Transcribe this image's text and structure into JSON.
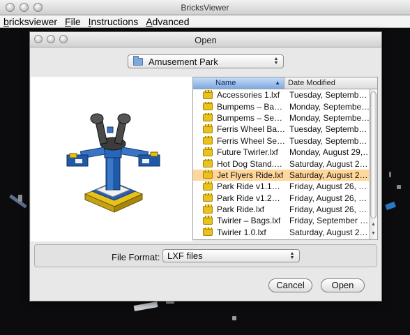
{
  "app": {
    "title": "BricksViewer"
  },
  "menubar": {
    "items": [
      "bricksviewer",
      "File",
      "Instructions",
      "Advanced"
    ]
  },
  "dialog": {
    "title": "Open",
    "folder": "Amusement Park",
    "columns": {
      "name": "Name",
      "date": "Date Modified"
    },
    "files": [
      {
        "name": "Accessories 1.lxf",
        "date": "Tuesday, Septemb…",
        "icon": "lego-brick-icon"
      },
      {
        "name": "Bumpems – Ba…",
        "date": "Monday, Septembe…",
        "icon": "lego-brick-icon"
      },
      {
        "name": "Bumpems – Se…",
        "date": "Monday, Septembe…",
        "icon": "lego-brick-icon"
      },
      {
        "name": "Ferris Wheel Ba…",
        "date": "Tuesday, Septemb…",
        "icon": "lego-brick-icon"
      },
      {
        "name": "Ferris Wheel Se…",
        "date": "Tuesday, Septemb…",
        "icon": "lego-brick-icon"
      },
      {
        "name": "Future Twirler.lxf",
        "date": "Monday, August 29,…",
        "icon": "lego-brick-icon"
      },
      {
        "name": "Hot Dog Stand.…",
        "date": "Saturday, August 2…",
        "icon": "lego-brick-icon"
      },
      {
        "name": "Jet Flyers Ride.lxf",
        "date": "Saturday, August 2…",
        "icon": "lego-brick-icon",
        "selected": true
      },
      {
        "name": "Park Ride v1.1…",
        "date": "Friday, August 26, …",
        "icon": "lego-brick-icon"
      },
      {
        "name": "Park Ride v1.2…",
        "date": "Friday, August 26, …",
        "icon": "lego-brick-icon"
      },
      {
        "name": "Park Ride.lxf",
        "date": "Friday, August 26, …",
        "icon": "lego-brick-icon"
      },
      {
        "name": "Twirler – Bags.lxf",
        "date": "Friday, September …",
        "icon": "lego-brick-icon"
      },
      {
        "name": "Twirler 1.0.lxf",
        "date": "Saturday, August 2…",
        "icon": "lego-brick-icon"
      }
    ],
    "file_format_label": "File Format:",
    "file_format_value": "LXF files",
    "cancel_label": "Cancel",
    "open_label": "Open",
    "colors": {
      "selection": "#ffd79a",
      "header_selected": "#7fa8e0"
    }
  }
}
